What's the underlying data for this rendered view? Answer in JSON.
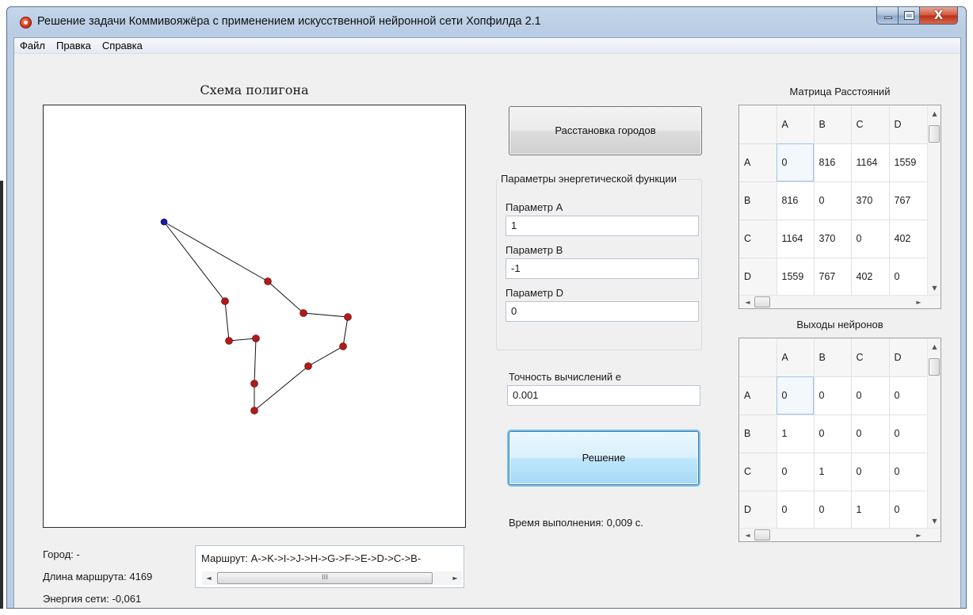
{
  "window": {
    "title": "Решение задачи Коммивояжёра с применением искусственной нейронной сети Хопфилда 2.1",
    "close_glyph": "X"
  },
  "menu": [
    "Файл",
    "Правка",
    "Справка"
  ],
  "polygon": {
    "caption": "Схема полигона",
    "start_color": "#1a1aa8",
    "city_color": "#b01a1a"
  },
  "buttons": {
    "place_cities": "Расстановка городов",
    "solve": "Решение"
  },
  "energy_params": {
    "group_title": "Параметры энергетической функции",
    "param_a_label": "Параметр A",
    "param_a_value": "1",
    "param_b_label": "Параметр B",
    "param_b_value": "-1",
    "param_d_label": "Параметр D",
    "param_d_value": "0"
  },
  "accuracy": {
    "label": "Точность вычислений e",
    "value": "0.001"
  },
  "exec_time": "Время выполнения: 0,009 с.",
  "distance_matrix": {
    "caption": "Матрица Расстояний",
    "columns": [
      "A",
      "B",
      "C",
      "D"
    ],
    "rows": [
      {
        "name": "A",
        "values": [
          "0",
          "816",
          "1164",
          "1559"
        ]
      },
      {
        "name": "B",
        "values": [
          "816",
          "0",
          "370",
          "767"
        ]
      },
      {
        "name": "C",
        "values": [
          "1164",
          "370",
          "0",
          "402"
        ]
      },
      {
        "name": "D",
        "values": [
          "1559",
          "767",
          "402",
          "0"
        ]
      }
    ]
  },
  "neuron_outputs": {
    "caption": "Выходы нейронов",
    "columns": [
      "A",
      "B",
      "C",
      "D"
    ],
    "rows": [
      {
        "name": "A",
        "values": [
          "0",
          "0",
          "0",
          "0"
        ]
      },
      {
        "name": "B",
        "values": [
          "1",
          "0",
          "0",
          "0"
        ]
      },
      {
        "name": "C",
        "values": [
          "0",
          "1",
          "0",
          "0"
        ]
      },
      {
        "name": "D",
        "values": [
          "0",
          "0",
          "1",
          "0"
        ]
      }
    ]
  },
  "status": {
    "city": "Город: -",
    "route_length": "Длина маршрута: 4169",
    "energy": "Энергия сети: -0,061"
  },
  "route": {
    "text": "Маршрут: A->K->I->J->H->G->F->E->D->C->B-",
    "thumb_grip": "III"
  },
  "scroll_glyphs": {
    "up": "▲",
    "down": "▼",
    "left": "◄",
    "right": "►"
  }
}
